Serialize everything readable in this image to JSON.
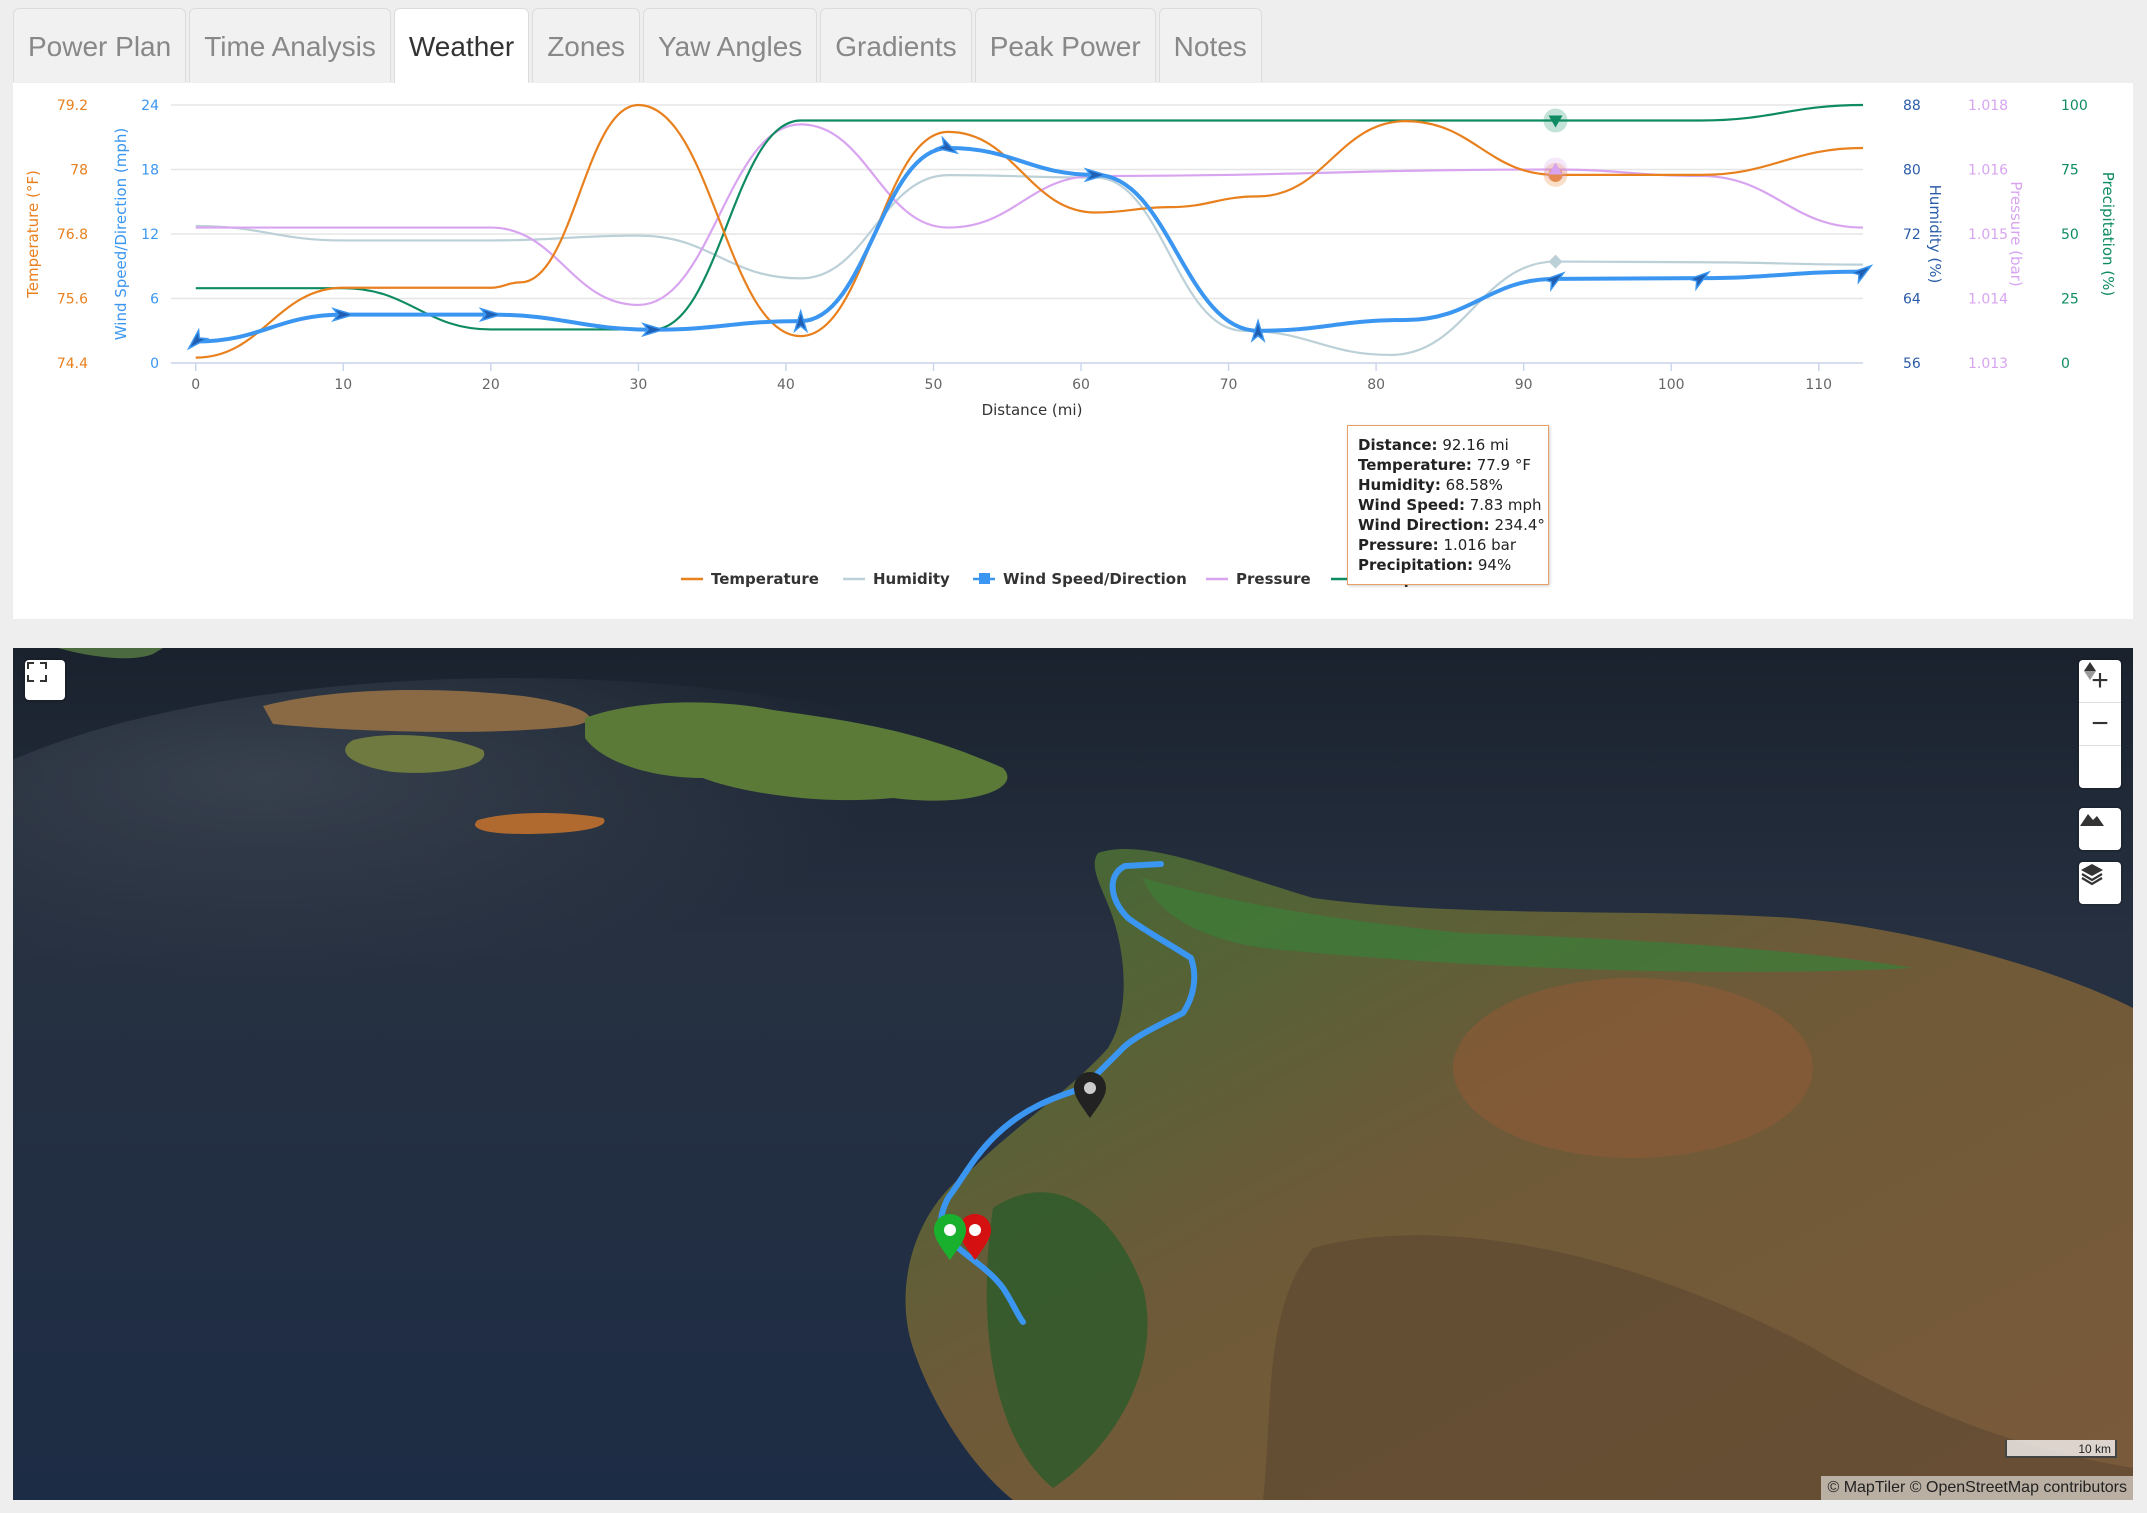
{
  "tabs": [
    {
      "label": "Power Plan",
      "active": false
    },
    {
      "label": "Time Analysis",
      "active": false
    },
    {
      "label": "Weather",
      "active": true
    },
    {
      "label": "Zones",
      "active": false
    },
    {
      "label": "Yaw Angles",
      "active": false
    },
    {
      "label": "Gradients",
      "active": false
    },
    {
      "label": "Peak Power",
      "active": false
    },
    {
      "label": "Notes",
      "active": false
    }
  ],
  "colors": {
    "temperature": "#e8801e",
    "humidity": "#bcd0d8",
    "wind": "#3a96f0",
    "pressure": "#d8a4f0",
    "precipitation": "#0f8b63",
    "humidity_axis": "#2b5ca8",
    "tooltip_border": "#e8a068"
  },
  "chart_data": {
    "type": "line",
    "title": "",
    "xlabel": "Distance (mi)",
    "x_ticks": [
      0,
      10,
      20,
      30,
      40,
      50,
      60,
      70,
      80,
      90,
      100,
      110
    ],
    "xlim": [
      -1,
      113
    ],
    "legend_position": "bottom-center",
    "grid": true,
    "axes": [
      {
        "id": "temp",
        "label": "Temperature (°F)",
        "side": "left",
        "ticks": [
          "74.4",
          "75.6",
          "76.8",
          "78",
          "79.2"
        ],
        "range": [
          74.4,
          79.2
        ]
      },
      {
        "id": "wind",
        "label": "Wind Speed/Direction (mph)",
        "side": "left",
        "ticks": [
          "0",
          "6",
          "12",
          "18",
          "24"
        ],
        "range": [
          0,
          24
        ]
      },
      {
        "id": "hum",
        "label": "Humidity (%)",
        "side": "right",
        "ticks": [
          "56",
          "64",
          "72",
          "80",
          "88"
        ],
        "range": [
          56,
          88
        ]
      },
      {
        "id": "pres",
        "label": "Pressure (bar)",
        "side": "right",
        "ticks": [
          "1.013",
          "1.014",
          "1.015",
          "1.016",
          "1.018"
        ],
        "range": [
          1.013,
          1.017
        ]
      },
      {
        "id": "prec",
        "label": "Precipitation (%)",
        "side": "right",
        "ticks": [
          "0",
          "25",
          "50",
          "75",
          "100"
        ],
        "range": [
          0,
          100
        ]
      }
    ],
    "series": [
      {
        "name": "Temperature",
        "axis": "temp",
        "color": "#e8801e",
        "points": [
          [
            0,
            74.5
          ],
          [
            10,
            75.8
          ],
          [
            20,
            75.8
          ],
          [
            22,
            75.9
          ],
          [
            30,
            79.2
          ],
          [
            41,
            74.9
          ],
          [
            51,
            78.7
          ],
          [
            61,
            77.2
          ],
          [
            66,
            77.3
          ],
          [
            72,
            77.5
          ],
          [
            82,
            78.9
          ],
          [
            92.16,
            77.9
          ],
          [
            102,
            77.9
          ],
          [
            113,
            78.4
          ]
        ]
      },
      {
        "name": "Humidity",
        "axis": "hum",
        "color": "#bcd0d8",
        "points": [
          [
            0,
            73
          ],
          [
            10,
            71.2
          ],
          [
            20,
            71.2
          ],
          [
            30,
            71.8
          ],
          [
            41,
            66.5
          ],
          [
            51,
            79.3
          ],
          [
            61,
            79
          ],
          [
            71,
            60
          ],
          [
            81,
            57
          ],
          [
            92.16,
            68.58
          ],
          [
            102,
            68.5
          ],
          [
            113,
            68.2
          ]
        ]
      },
      {
        "name": "Wind Speed/Direction",
        "axis": "wind",
        "color": "#3a96f0",
        "points": [
          [
            0,
            2
          ],
          [
            10,
            4.5
          ],
          [
            20,
            4.5
          ],
          [
            31,
            3.1
          ],
          [
            41,
            3.9
          ],
          [
            51,
            20
          ],
          [
            61,
            17.5
          ],
          [
            72,
            3
          ],
          [
            82,
            4
          ],
          [
            92.16,
            7.83
          ],
          [
            102,
            7.9
          ],
          [
            113,
            8.5
          ]
        ],
        "direction_markers": [
          [
            0,
            2,
            45
          ],
          [
            10,
            4.5,
            270
          ],
          [
            20,
            4.5,
            270
          ],
          [
            31,
            3.1,
            270
          ],
          [
            41,
            3.9,
            180
          ],
          [
            51,
            20,
            300
          ],
          [
            61,
            17.5,
            270
          ],
          [
            72,
            3,
            180
          ],
          [
            92.16,
            7.83,
            234
          ],
          [
            102,
            7.9,
            234
          ],
          [
            113,
            8.5,
            234
          ]
        ]
      },
      {
        "name": "Pressure",
        "axis": "pres",
        "color": "#d8a4f0",
        "points": [
          [
            0,
            1.0151
          ],
          [
            10,
            1.0151
          ],
          [
            20,
            1.0151
          ],
          [
            30,
            1.0139
          ],
          [
            41,
            1.0167
          ],
          [
            51,
            1.0151
          ],
          [
            61,
            1.0159
          ],
          [
            92.16,
            1.016
          ],
          [
            102,
            1.0159
          ],
          [
            113,
            1.0151
          ]
        ]
      },
      {
        "name": "Precipitation",
        "axis": "prec",
        "color": "#0f8b63",
        "points": [
          [
            0,
            29
          ],
          [
            10,
            29
          ],
          [
            20,
            13
          ],
          [
            31,
            13
          ],
          [
            41,
            94
          ],
          [
            51,
            94
          ],
          [
            61,
            94
          ],
          [
            92.16,
            94
          ],
          [
            102,
            94
          ],
          [
            113,
            100
          ]
        ]
      }
    ],
    "hover_x": 92.16
  },
  "tooltip": {
    "rows": [
      {
        "label": "Distance:",
        "value": "92.16 mi"
      },
      {
        "label": "Temperature:",
        "value": "77.9 °F"
      },
      {
        "label": "Humidity:",
        "value": "68.58%"
      },
      {
        "label": "Wind Speed:",
        "value": "7.83 mph"
      },
      {
        "label": "Wind Direction:",
        "value": "234.4°"
      },
      {
        "label": "Pressure:",
        "value": "1.016 bar"
      },
      {
        "label": "Precipitation:",
        "value": "94%"
      }
    ]
  },
  "map": {
    "fullscreen_icon": "fullscreen-icon",
    "zoom_in_icon": "plus-icon",
    "zoom_out_icon": "minus-icon",
    "compass_icon": "compass-icon",
    "terrain_icon": "mountain-icon",
    "layers_icon": "layers-icon",
    "scale_label": "10 km",
    "attribution": "© MapTiler © OpenStreetMap contributors",
    "route_color": "#3a96f0"
  }
}
